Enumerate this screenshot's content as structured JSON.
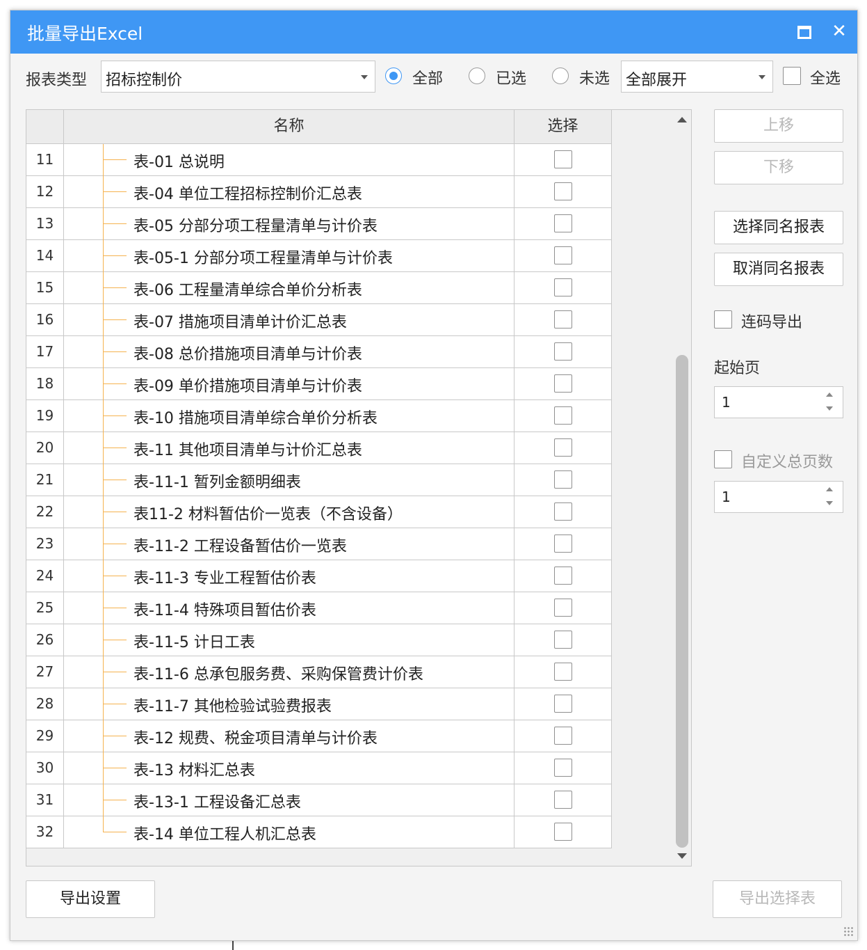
{
  "window": {
    "title": "批量导出Excel"
  },
  "toolbar": {
    "report_type_label": "报表类型",
    "report_type_value": "招标控制价",
    "radio_all": "全部",
    "radio_selected": "已选",
    "radio_unselected": "未选",
    "radio_checked": "全部",
    "expand_value": "全部展开",
    "select_all_label": "全选"
  },
  "grid": {
    "headers": {
      "name": "名称",
      "select": "选择"
    },
    "rows": [
      {
        "num": "11",
        "name": "表-01 总说明"
      },
      {
        "num": "12",
        "name": "表-04 单位工程招标控制价汇总表"
      },
      {
        "num": "13",
        "name": "表-05 分部分项工程量清单与计价表"
      },
      {
        "num": "14",
        "name": "表-05-1 分部分项工程量清单与计价表"
      },
      {
        "num": "15",
        "name": "表-06 工程量清单综合单价分析表"
      },
      {
        "num": "16",
        "name": "表-07 措施项目清单计价汇总表"
      },
      {
        "num": "17",
        "name": "表-08 总价措施项目清单与计价表"
      },
      {
        "num": "18",
        "name": "表-09 单价措施项目清单与计价表"
      },
      {
        "num": "19",
        "name": "表-10 措施项目清单综合单价分析表"
      },
      {
        "num": "20",
        "name": "表-11 其他项目清单与计价汇总表"
      },
      {
        "num": "21",
        "name": "表-11-1 暂列金额明细表"
      },
      {
        "num": "22",
        "name": "表11-2 材料暂估价一览表（不含设备）"
      },
      {
        "num": "23",
        "name": "表-11-2 工程设备暂估价一览表"
      },
      {
        "num": "24",
        "name": "表-11-3 专业工程暂估价表"
      },
      {
        "num": "25",
        "name": "表-11-4 特殊项目暂估价表"
      },
      {
        "num": "26",
        "name": "表-11-5 计日工表"
      },
      {
        "num": "27",
        "name": "表-11-6 总承包服务费、采购保管费计价表"
      },
      {
        "num": "28",
        "name": "表-11-7 其他检验试验费报表"
      },
      {
        "num": "29",
        "name": "表-12 规费、税金项目清单与计价表"
      },
      {
        "num": "30",
        "name": "表-13 材料汇总表"
      },
      {
        "num": "31",
        "name": "表-13-1 工程设备汇总表"
      },
      {
        "num": "32",
        "name": "表-14 单位工程人机汇总表"
      }
    ]
  },
  "side": {
    "move_up": "上移",
    "move_down": "下移",
    "select_same": "选择同名报表",
    "cancel_same": "取消同名报表",
    "continuous_label": "连码导出",
    "start_page_label": "起始页",
    "start_page_value": "1",
    "custom_total_label": "自定义总页数",
    "custom_total_value": "1"
  },
  "footer": {
    "export_settings": "导出设置",
    "export_selected": "导出选择表"
  },
  "colors": {
    "titlebar": "#3f97f4",
    "tree_line": "#f5b24f"
  }
}
